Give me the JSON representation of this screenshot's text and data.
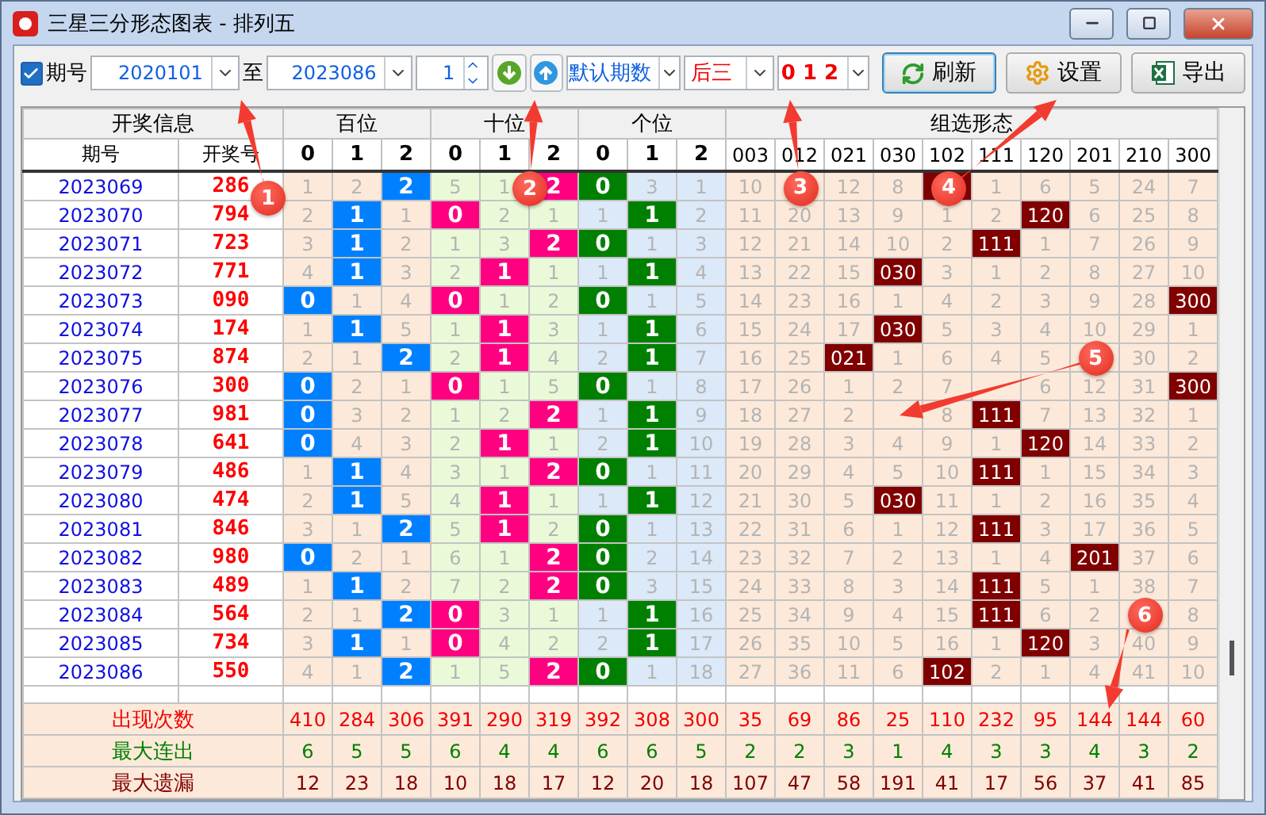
{
  "window": {
    "title": "三星三分形态图表 - 排列五"
  },
  "toolbar": {
    "issue_filter": {
      "label": "期号",
      "checked": true
    },
    "from": "2020101",
    "to_label": "至",
    "to": "2023086",
    "step": "1",
    "range_mode": "默认期数",
    "position": "后三",
    "digits": "0 1 2",
    "buttons": [
      "刷新",
      "设置",
      "导出"
    ]
  },
  "table": {
    "group_headers": [
      "开奖信息",
      "百位",
      "十位",
      "个位",
      "组选形态"
    ],
    "columns": [
      "期号",
      "开奖号",
      "0",
      "1",
      "2",
      "0",
      "1",
      "2",
      "0",
      "1",
      "2",
      "003",
      "012",
      "021",
      "030",
      "102",
      "111",
      "120",
      "201",
      "210",
      "300"
    ],
    "rows": [
      {
        "cells": [
          {
            "text": "2023069",
            "hit": false
          },
          {
            "text": "286",
            "hit": false
          },
          {
            "text": "1",
            "hit": false
          },
          {
            "text": "2",
            "hit": false
          },
          {
            "text": "2",
            "hit": true
          },
          {
            "text": "5",
            "hit": false
          },
          {
            "text": "1",
            "hit": false
          },
          {
            "text": "2",
            "hit": true
          },
          {
            "text": "0",
            "hit": true
          },
          {
            "text": "3",
            "hit": false
          },
          {
            "text": "1",
            "hit": false
          },
          {
            "text": "10",
            "hit": false
          },
          {
            "hit": false
          },
          {
            "text": "12",
            "hit": false
          },
          {
            "text": "8",
            "hit": false
          },
          {
            "hit": true
          },
          {
            "text": "1",
            "hit": false
          },
          {
            "text": "6",
            "hit": false
          },
          {
            "text": "5",
            "hit": false
          },
          {
            "text": "24",
            "hit": false
          },
          {
            "text": "7",
            "hit": false
          }
        ]
      },
      {
        "cells": [
          {
            "text": "2023070",
            "hit": false
          },
          {
            "text": "794",
            "hit": false
          },
          {
            "text": "2",
            "hit": false
          },
          {
            "text": "1",
            "hit": true
          },
          {
            "text": "1",
            "hit": false
          },
          {
            "text": "0",
            "hit": true
          },
          {
            "text": "2",
            "hit": false
          },
          {
            "text": "1",
            "hit": false
          },
          {
            "text": "1",
            "hit": false
          },
          {
            "text": "1",
            "hit": true
          },
          {
            "text": "2",
            "hit": false
          },
          {
            "text": "11",
            "hit": false
          },
          {
            "text": "20",
            "hit": false
          },
          {
            "text": "13",
            "hit": false
          },
          {
            "text": "9",
            "hit": false
          },
          {
            "text": "1",
            "hit": false
          },
          {
            "text": "2",
            "hit": false
          },
          {
            "text": "120",
            "hit": true
          },
          {
            "text": "6",
            "hit": false
          },
          {
            "text": "25",
            "hit": false
          },
          {
            "text": "8",
            "hit": false
          }
        ]
      },
      {
        "cells": [
          {
            "text": "2023071",
            "hit": false
          },
          {
            "text": "723",
            "hit": false
          },
          {
            "text": "3",
            "hit": false
          },
          {
            "text": "1",
            "hit": true
          },
          {
            "text": "2",
            "hit": false
          },
          {
            "text": "1",
            "hit": false
          },
          {
            "text": "3",
            "hit": false
          },
          {
            "text": "2",
            "hit": true
          },
          {
            "text": "0",
            "hit": true
          },
          {
            "text": "1",
            "hit": false
          },
          {
            "text": "3",
            "hit": false
          },
          {
            "text": "12",
            "hit": false
          },
          {
            "text": "21",
            "hit": false
          },
          {
            "text": "14",
            "hit": false
          },
          {
            "text": "10",
            "hit": false
          },
          {
            "text": "2",
            "hit": false
          },
          {
            "text": "111",
            "hit": true
          },
          {
            "text": "1",
            "hit": false
          },
          {
            "text": "7",
            "hit": false
          },
          {
            "text": "26",
            "hit": false
          },
          {
            "text": "9",
            "hit": false
          }
        ]
      },
      {
        "cells": [
          {
            "text": "2023072",
            "hit": false
          },
          {
            "text": "771",
            "hit": false
          },
          {
            "text": "4",
            "hit": false
          },
          {
            "text": "1",
            "hit": true
          },
          {
            "text": "3",
            "hit": false
          },
          {
            "text": "2",
            "hit": false
          },
          {
            "text": "1",
            "hit": true
          },
          {
            "text": "1",
            "hit": false
          },
          {
            "text": "1",
            "hit": false
          },
          {
            "text": "1",
            "hit": true
          },
          {
            "text": "4",
            "hit": false
          },
          {
            "text": "13",
            "hit": false
          },
          {
            "text": "22",
            "hit": false
          },
          {
            "text": "15",
            "hit": false
          },
          {
            "text": "030",
            "hit": true
          },
          {
            "text": "3",
            "hit": false
          },
          {
            "text": "1",
            "hit": false
          },
          {
            "text": "2",
            "hit": false
          },
          {
            "text": "8",
            "hit": false
          },
          {
            "text": "27",
            "hit": false
          },
          {
            "text": "10",
            "hit": false
          }
        ]
      },
      {
        "cells": [
          {
            "text": "2023073",
            "hit": false
          },
          {
            "text": "090",
            "hit": false
          },
          {
            "text": "0",
            "hit": true
          },
          {
            "text": "1",
            "hit": false
          },
          {
            "text": "4",
            "hit": false
          },
          {
            "text": "0",
            "hit": true
          },
          {
            "text": "1",
            "hit": false
          },
          {
            "text": "2",
            "hit": false
          },
          {
            "text": "0",
            "hit": true
          },
          {
            "text": "1",
            "hit": false
          },
          {
            "text": "5",
            "hit": false
          },
          {
            "text": "14",
            "hit": false
          },
          {
            "text": "23",
            "hit": false
          },
          {
            "text": "16",
            "hit": false
          },
          {
            "text": "1",
            "hit": false
          },
          {
            "text": "4",
            "hit": false
          },
          {
            "text": "2",
            "hit": false
          },
          {
            "text": "3",
            "hit": false
          },
          {
            "text": "9",
            "hit": false
          },
          {
            "text": "28",
            "hit": false
          },
          {
            "text": "300",
            "hit": true
          }
        ]
      },
      {
        "cells": [
          {
            "text": "2023074",
            "hit": false
          },
          {
            "text": "174",
            "hit": false
          },
          {
            "text": "1",
            "hit": false
          },
          {
            "text": "1",
            "hit": true
          },
          {
            "text": "5",
            "hit": false
          },
          {
            "text": "1",
            "hit": false
          },
          {
            "text": "1",
            "hit": true
          },
          {
            "text": "3",
            "hit": false
          },
          {
            "text": "1",
            "hit": false
          },
          {
            "text": "1",
            "hit": true
          },
          {
            "text": "6",
            "hit": false
          },
          {
            "text": "15",
            "hit": false
          },
          {
            "text": "24",
            "hit": false
          },
          {
            "text": "17",
            "hit": false
          },
          {
            "text": "030",
            "hit": true
          },
          {
            "text": "5",
            "hit": false
          },
          {
            "text": "3",
            "hit": false
          },
          {
            "text": "4",
            "hit": false
          },
          {
            "text": "10",
            "hit": false
          },
          {
            "text": "29",
            "hit": false
          },
          {
            "text": "1",
            "hit": false
          }
        ]
      },
      {
        "cells": [
          {
            "text": "2023075",
            "hit": false
          },
          {
            "text": "874",
            "hit": false
          },
          {
            "text": "2",
            "hit": false
          },
          {
            "text": "1",
            "hit": false
          },
          {
            "text": "2",
            "hit": true
          },
          {
            "text": "2",
            "hit": false
          },
          {
            "text": "1",
            "hit": true
          },
          {
            "text": "4",
            "hit": false
          },
          {
            "text": "2",
            "hit": false
          },
          {
            "text": "1",
            "hit": true
          },
          {
            "text": "7",
            "hit": false
          },
          {
            "text": "16",
            "hit": false
          },
          {
            "text": "25",
            "hit": false
          },
          {
            "text": "021",
            "hit": true
          },
          {
            "text": "1",
            "hit": false
          },
          {
            "text": "6",
            "hit": false
          },
          {
            "text": "4",
            "hit": false
          },
          {
            "text": "5",
            "hit": false
          },
          {
            "hit": false
          },
          {
            "text": "30",
            "hit": false
          },
          {
            "text": "2",
            "hit": false
          }
        ]
      },
      {
        "cells": [
          {
            "text": "2023076",
            "hit": false
          },
          {
            "text": "300",
            "hit": false
          },
          {
            "text": "0",
            "hit": true
          },
          {
            "text": "2",
            "hit": false
          },
          {
            "text": "1",
            "hit": false
          },
          {
            "text": "0",
            "hit": true
          },
          {
            "text": "1",
            "hit": false
          },
          {
            "text": "5",
            "hit": false
          },
          {
            "text": "0",
            "hit": true
          },
          {
            "text": "1",
            "hit": false
          },
          {
            "text": "8",
            "hit": false
          },
          {
            "text": "17",
            "hit": false
          },
          {
            "text": "26",
            "hit": false
          },
          {
            "text": "1",
            "hit": false
          },
          {
            "text": "2",
            "hit": false
          },
          {
            "text": "7",
            "hit": false
          },
          {
            "hit": false
          },
          {
            "text": "6",
            "hit": false
          },
          {
            "text": "12",
            "hit": false
          },
          {
            "text": "31",
            "hit": false
          },
          {
            "text": "300",
            "hit": true
          }
        ]
      },
      {
        "cells": [
          {
            "text": "2023077",
            "hit": false
          },
          {
            "text": "981",
            "hit": false
          },
          {
            "text": "0",
            "hit": true
          },
          {
            "text": "3",
            "hit": false
          },
          {
            "text": "2",
            "hit": false
          },
          {
            "text": "1",
            "hit": false
          },
          {
            "text": "2",
            "hit": false
          },
          {
            "text": "2",
            "hit": true
          },
          {
            "text": "1",
            "hit": false
          },
          {
            "text": "1",
            "hit": true
          },
          {
            "text": "9",
            "hit": false
          },
          {
            "text": "18",
            "hit": false
          },
          {
            "text": "27",
            "hit": false
          },
          {
            "text": "2",
            "hit": false
          },
          {
            "hit": false
          },
          {
            "text": "8",
            "hit": false
          },
          {
            "text": "111",
            "hit": true
          },
          {
            "text": "7",
            "hit": false
          },
          {
            "text": "13",
            "hit": false
          },
          {
            "text": "32",
            "hit": false
          },
          {
            "text": "1",
            "hit": false
          }
        ]
      },
      {
        "cells": [
          {
            "text": "2023078",
            "hit": false
          },
          {
            "text": "641",
            "hit": false
          },
          {
            "text": "0",
            "hit": true
          },
          {
            "text": "4",
            "hit": false
          },
          {
            "text": "3",
            "hit": false
          },
          {
            "text": "2",
            "hit": false
          },
          {
            "text": "1",
            "hit": true
          },
          {
            "text": "1",
            "hit": false
          },
          {
            "text": "2",
            "hit": false
          },
          {
            "text": "1",
            "hit": true
          },
          {
            "text": "10",
            "hit": false
          },
          {
            "text": "19",
            "hit": false
          },
          {
            "text": "28",
            "hit": false
          },
          {
            "text": "3",
            "hit": false
          },
          {
            "text": "4",
            "hit": false
          },
          {
            "text": "9",
            "hit": false
          },
          {
            "text": "1",
            "hit": false
          },
          {
            "text": "120",
            "hit": true
          },
          {
            "text": "14",
            "hit": false
          },
          {
            "text": "33",
            "hit": false
          },
          {
            "text": "2",
            "hit": false
          }
        ]
      },
      {
        "cells": [
          {
            "text": "2023079",
            "hit": false
          },
          {
            "text": "486",
            "hit": false
          },
          {
            "text": "1",
            "hit": false
          },
          {
            "text": "1",
            "hit": true
          },
          {
            "text": "4",
            "hit": false
          },
          {
            "text": "3",
            "hit": false
          },
          {
            "text": "1",
            "hit": false
          },
          {
            "text": "2",
            "hit": true
          },
          {
            "text": "0",
            "hit": true
          },
          {
            "text": "1",
            "hit": false
          },
          {
            "text": "11",
            "hit": false
          },
          {
            "text": "20",
            "hit": false
          },
          {
            "text": "29",
            "hit": false
          },
          {
            "text": "4",
            "hit": false
          },
          {
            "text": "5",
            "hit": false
          },
          {
            "text": "10",
            "hit": false
          },
          {
            "text": "111",
            "hit": true
          },
          {
            "text": "1",
            "hit": false
          },
          {
            "text": "15",
            "hit": false
          },
          {
            "text": "34",
            "hit": false
          },
          {
            "text": "3",
            "hit": false
          }
        ]
      },
      {
        "cells": [
          {
            "text": "2023080",
            "hit": false
          },
          {
            "text": "474",
            "hit": false
          },
          {
            "text": "2",
            "hit": false
          },
          {
            "text": "1",
            "hit": true
          },
          {
            "text": "5",
            "hit": false
          },
          {
            "text": "4",
            "hit": false
          },
          {
            "text": "1",
            "hit": true
          },
          {
            "text": "1",
            "hit": false
          },
          {
            "text": "1",
            "hit": false
          },
          {
            "text": "1",
            "hit": true
          },
          {
            "text": "12",
            "hit": false
          },
          {
            "text": "21",
            "hit": false
          },
          {
            "text": "30",
            "hit": false
          },
          {
            "text": "5",
            "hit": false
          },
          {
            "text": "030",
            "hit": true
          },
          {
            "text": "11",
            "hit": false
          },
          {
            "text": "1",
            "hit": false
          },
          {
            "text": "2",
            "hit": false
          },
          {
            "text": "16",
            "hit": false
          },
          {
            "text": "35",
            "hit": false
          },
          {
            "text": "4",
            "hit": false
          }
        ]
      },
      {
        "cells": [
          {
            "text": "2023081",
            "hit": false
          },
          {
            "text": "846",
            "hit": false
          },
          {
            "text": "3",
            "hit": false
          },
          {
            "text": "1",
            "hit": false
          },
          {
            "text": "2",
            "hit": true
          },
          {
            "text": "5",
            "hit": false
          },
          {
            "text": "1",
            "hit": true
          },
          {
            "text": "2",
            "hit": false
          },
          {
            "text": "0",
            "hit": true
          },
          {
            "text": "1",
            "hit": false
          },
          {
            "text": "13",
            "hit": false
          },
          {
            "text": "22",
            "hit": false
          },
          {
            "text": "31",
            "hit": false
          },
          {
            "text": "6",
            "hit": false
          },
          {
            "text": "1",
            "hit": false
          },
          {
            "text": "12",
            "hit": false
          },
          {
            "text": "111",
            "hit": true
          },
          {
            "text": "3",
            "hit": false
          },
          {
            "text": "17",
            "hit": false
          },
          {
            "text": "36",
            "hit": false
          },
          {
            "text": "5",
            "hit": false
          }
        ]
      },
      {
        "cells": [
          {
            "text": "2023082",
            "hit": false
          },
          {
            "text": "980",
            "hit": false
          },
          {
            "text": "0",
            "hit": true
          },
          {
            "text": "2",
            "hit": false
          },
          {
            "text": "1",
            "hit": false
          },
          {
            "text": "6",
            "hit": false
          },
          {
            "text": "1",
            "hit": false
          },
          {
            "text": "2",
            "hit": true
          },
          {
            "text": "0",
            "hit": true
          },
          {
            "text": "2",
            "hit": false
          },
          {
            "text": "14",
            "hit": false
          },
          {
            "text": "23",
            "hit": false
          },
          {
            "text": "32",
            "hit": false
          },
          {
            "text": "7",
            "hit": false
          },
          {
            "text": "2",
            "hit": false
          },
          {
            "text": "13",
            "hit": false
          },
          {
            "text": "1",
            "hit": false
          },
          {
            "text": "4",
            "hit": false
          },
          {
            "text": "201",
            "hit": true
          },
          {
            "text": "37",
            "hit": false
          },
          {
            "text": "6",
            "hit": false
          }
        ]
      },
      {
        "cells": [
          {
            "text": "2023083",
            "hit": false
          },
          {
            "text": "489",
            "hit": false
          },
          {
            "text": "1",
            "hit": false
          },
          {
            "text": "1",
            "hit": true
          },
          {
            "text": "2",
            "hit": false
          },
          {
            "text": "7",
            "hit": false
          },
          {
            "text": "2",
            "hit": false
          },
          {
            "text": "2",
            "hit": true
          },
          {
            "text": "0",
            "hit": true
          },
          {
            "text": "3",
            "hit": false
          },
          {
            "text": "15",
            "hit": false
          },
          {
            "text": "24",
            "hit": false
          },
          {
            "text": "33",
            "hit": false
          },
          {
            "text": "8",
            "hit": false
          },
          {
            "text": "3",
            "hit": false
          },
          {
            "text": "14",
            "hit": false
          },
          {
            "text": "111",
            "hit": true
          },
          {
            "text": "5",
            "hit": false
          },
          {
            "text": "1",
            "hit": false
          },
          {
            "text": "38",
            "hit": false
          },
          {
            "text": "7",
            "hit": false
          }
        ]
      },
      {
        "cells": [
          {
            "text": "2023084",
            "hit": false
          },
          {
            "text": "564",
            "hit": false
          },
          {
            "text": "2",
            "hit": false
          },
          {
            "text": "1",
            "hit": false
          },
          {
            "text": "2",
            "hit": true
          },
          {
            "text": "0",
            "hit": true
          },
          {
            "text": "3",
            "hit": false
          },
          {
            "text": "1",
            "hit": false
          },
          {
            "text": "1",
            "hit": false
          },
          {
            "text": "1",
            "hit": true
          },
          {
            "text": "16",
            "hit": false
          },
          {
            "text": "25",
            "hit": false
          },
          {
            "text": "34",
            "hit": false
          },
          {
            "text": "9",
            "hit": false
          },
          {
            "text": "4",
            "hit": false
          },
          {
            "text": "15",
            "hit": false
          },
          {
            "text": "111",
            "hit": true
          },
          {
            "text": "6",
            "hit": false
          },
          {
            "text": "2",
            "hit": false
          },
          {
            "hit": false
          },
          {
            "text": "8",
            "hit": false
          }
        ]
      },
      {
        "cells": [
          {
            "text": "2023085",
            "hit": false
          },
          {
            "text": "734",
            "hit": false
          },
          {
            "text": "3",
            "hit": false
          },
          {
            "text": "1",
            "hit": true
          },
          {
            "text": "1",
            "hit": false
          },
          {
            "text": "0",
            "hit": true
          },
          {
            "text": "4",
            "hit": false
          },
          {
            "text": "2",
            "hit": false
          },
          {
            "text": "2",
            "hit": false
          },
          {
            "text": "1",
            "hit": true
          },
          {
            "text": "17",
            "hit": false
          },
          {
            "text": "26",
            "hit": false
          },
          {
            "text": "35",
            "hit": false
          },
          {
            "text": "10",
            "hit": false
          },
          {
            "text": "5",
            "hit": false
          },
          {
            "text": "16",
            "hit": false
          },
          {
            "text": "1",
            "hit": false
          },
          {
            "text": "120",
            "hit": true
          },
          {
            "text": "3",
            "hit": false
          },
          {
            "text": "40",
            "hit": false
          },
          {
            "text": "9",
            "hit": false
          }
        ]
      },
      {
        "cells": [
          {
            "text": "2023086",
            "hit": false
          },
          {
            "text": "550",
            "hit": false
          },
          {
            "text": "4",
            "hit": false
          },
          {
            "text": "1",
            "hit": false
          },
          {
            "text": "2",
            "hit": true
          },
          {
            "text": "1",
            "hit": false
          },
          {
            "text": "5",
            "hit": false
          },
          {
            "text": "2",
            "hit": true
          },
          {
            "text": "0",
            "hit": true
          },
          {
            "text": "1",
            "hit": false
          },
          {
            "text": "18",
            "hit": false
          },
          {
            "text": "27",
            "hit": false
          },
          {
            "text": "36",
            "hit": false
          },
          {
            "text": "11",
            "hit": false
          },
          {
            "text": "6",
            "hit": false
          },
          {
            "text": "102",
            "hit": true
          },
          {
            "text": "2",
            "hit": false
          },
          {
            "text": "1",
            "hit": false
          },
          {
            "text": "4",
            "hit": false
          },
          {
            "text": "41",
            "hit": false
          },
          {
            "text": "10",
            "hit": false
          }
        ]
      }
    ],
    "summary": [
      {
        "kind": "count",
        "label": "出现次数",
        "values": [
          "410",
          "284",
          "306",
          "391",
          "290",
          "319",
          "392",
          "308",
          "300",
          "35",
          "69",
          "86",
          "25",
          "110",
          "232",
          "95",
          "144",
          "144",
          "60"
        ]
      },
      {
        "kind": "streak",
        "label": "最大连出",
        "values": [
          "6",
          "5",
          "5",
          "6",
          "4",
          "4",
          "6",
          "6",
          "5",
          "2",
          "2",
          "3",
          "1",
          "4",
          "3",
          "3",
          "4",
          "3",
          "2"
        ]
      },
      {
        "kind": "miss",
        "label": "最大遗漏",
        "values": [
          "12",
          "23",
          "18",
          "10",
          "18",
          "17",
          "12",
          "20",
          "18",
          "107",
          "47",
          "58",
          "191",
          "41",
          "17",
          "56",
          "37",
          "41",
          "85"
        ]
      }
    ]
  },
  "annotations": [
    "1",
    "2",
    "3",
    "4",
    "5",
    "6"
  ]
}
